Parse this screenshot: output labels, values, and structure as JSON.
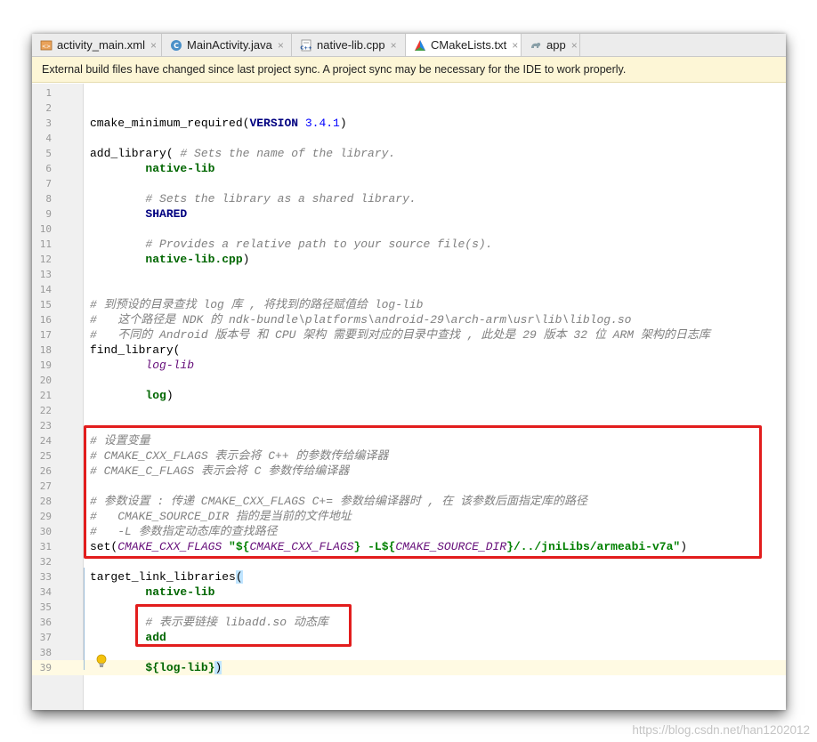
{
  "tabs": [
    {
      "label": "activity_main.xml",
      "icon": "xml-layout-icon",
      "active": false
    },
    {
      "label": "MainActivity.java",
      "icon": "java-class-icon",
      "active": false
    },
    {
      "label": "native-lib.cpp",
      "icon": "cpp-file-icon",
      "active": false
    },
    {
      "label": "CMakeLists.txt",
      "icon": "cmake-icon",
      "active": true
    },
    {
      "label": "app",
      "icon": "gradle-icon",
      "active": false
    }
  ],
  "close_glyph": "×",
  "banner": {
    "text": "External build files have changed since last project sync. A project sync may be necessary for the IDE to work properly."
  },
  "lines": [
    [],
    [],
    [
      [
        "fn",
        "cmake_minimum_required("
      ],
      [
        "kw",
        "VERSION"
      ],
      [
        "num",
        " 3.4.1"
      ],
      [
        "fn",
        ")"
      ]
    ],
    [],
    [
      [
        "fn",
        "add_library( "
      ],
      [
        "cm",
        "# Sets the name of the library."
      ]
    ],
    [
      [
        "pl",
        "        "
      ],
      [
        "gr",
        "native-lib"
      ]
    ],
    [],
    [
      [
        "pl",
        "        "
      ],
      [
        "cm",
        "# Sets the library as a shared library."
      ]
    ],
    [
      [
        "pl",
        "        "
      ],
      [
        "kw",
        "SHARED"
      ]
    ],
    [],
    [
      [
        "pl",
        "        "
      ],
      [
        "cm",
        "# Provides a relative path to your source file(s)."
      ]
    ],
    [
      [
        "pl",
        "        "
      ],
      [
        "gr",
        "native-lib.cpp"
      ],
      [
        "fn",
        ")"
      ]
    ],
    [],
    [],
    [
      [
        "cm",
        "# 到预设的目录查找 log 库 , 将找到的路径赋值给 log-lib"
      ]
    ],
    [
      [
        "cm",
        "#   这个路径是 NDK 的 ndk-bundle\\platforms\\android-29\\arch-arm\\usr\\lib\\liblog.so"
      ]
    ],
    [
      [
        "cm",
        "#   不同的 Android 版本号 和 CPU 架构 需要到对应的目录中查找 , 此处是 29 版本 32 位 ARM 架构的日志库"
      ]
    ],
    [
      [
        "fn",
        "find_library("
      ]
    ],
    [
      [
        "pl",
        "        "
      ],
      [
        "va",
        "log-lib"
      ]
    ],
    [],
    [
      [
        "pl",
        "        "
      ],
      [
        "gr",
        "log"
      ],
      [
        "fn",
        ")"
      ]
    ],
    [],
    [],
    [
      [
        "cm",
        "# 设置变量"
      ]
    ],
    [
      [
        "cm",
        "# CMAKE_CXX_FLAGS 表示会将 C++ 的参数传给编译器"
      ]
    ],
    [
      [
        "cm",
        "# CMAKE_C_FLAGS 表示会将 C 参数传给编译器"
      ]
    ],
    [],
    [
      [
        "cm",
        "# 参数设置 : 传递 CMAKE_CXX_FLAGS C+= 参数给编译器时 , 在 该参数后面指定库的路径"
      ]
    ],
    [
      [
        "cm",
        "#   CMAKE_SOURCE_DIR 指的是当前的文件地址"
      ]
    ],
    [
      [
        "cm",
        "#   -L 参数指定动态库的查找路径"
      ]
    ],
    [
      [
        "fn",
        "set("
      ],
      [
        "va",
        "CMAKE_CXX_FLAGS"
      ],
      [
        "st",
        " \"${"
      ],
      [
        "va",
        "CMAKE_CXX_FLAGS"
      ],
      [
        "st",
        "} -L${"
      ],
      [
        "va",
        "CMAKE_SOURCE_DIR"
      ],
      [
        "st",
        "}/../jniLibs/armeabi-v7a\""
      ],
      [
        "fn",
        ")"
      ]
    ],
    [],
    [
      [
        "fn",
        "target_link_libraries"
      ],
      [
        "bracket",
        "("
      ]
    ],
    [
      [
        "pl",
        "        "
      ],
      [
        "gr",
        "native-lib"
      ]
    ],
    [],
    [
      [
        "pl",
        "        "
      ],
      [
        "cm",
        "# 表示要链接 libadd.so 动态库"
      ]
    ],
    [
      [
        "pl",
        "        "
      ],
      [
        "gr",
        "add"
      ]
    ],
    [],
    [
      [
        "pl",
        "        "
      ],
      [
        "gr",
        "${log-lib}"
      ],
      [
        "bracket",
        ")"
      ]
    ]
  ],
  "current_line": 39,
  "watermark": "https://blog.csdn.net/han1202012"
}
